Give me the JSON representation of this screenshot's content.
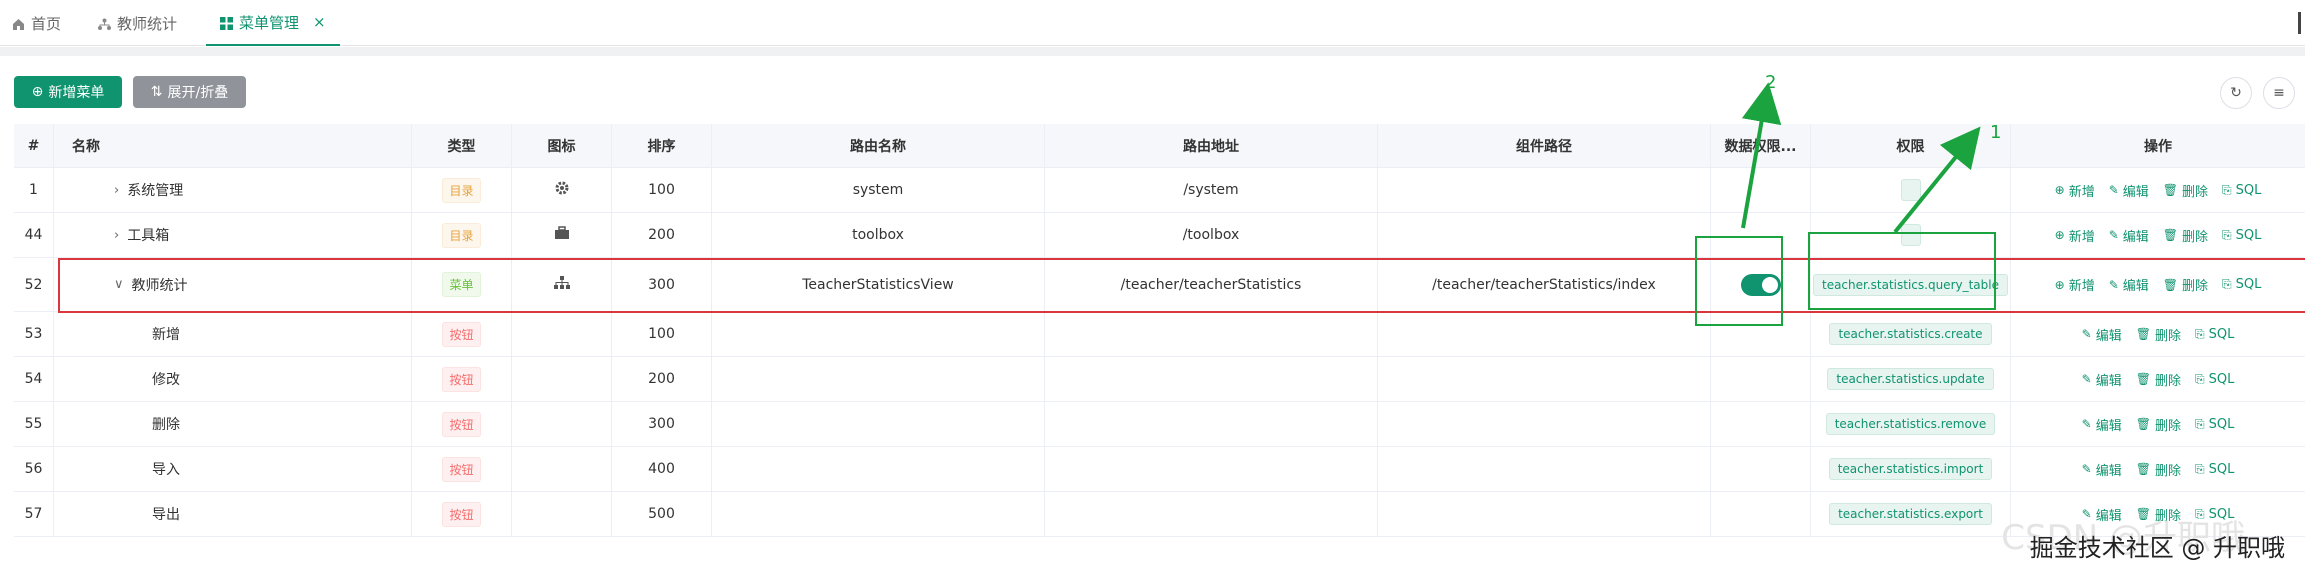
{
  "tabs": [
    {
      "label": "首页",
      "icon": "home-icon"
    },
    {
      "label": "教师统计",
      "icon": "chart-icon"
    },
    {
      "label": "菜单管理",
      "icon": "grid-icon",
      "active": true
    }
  ],
  "toolbar": {
    "add_label": "新增菜单",
    "expand_label": "展开/折叠"
  },
  "table": {
    "headers": [
      "#",
      "名称",
      "类型",
      "图标",
      "排序",
      "路由名称",
      "路由地址",
      "组件路径",
      "数据权限...",
      "权限",
      "操作"
    ],
    "rows": [
      {
        "id": "1",
        "name": "系统管理",
        "type": "目录",
        "icon": "gear-icon",
        "sort": "100",
        "route_name": "system",
        "route_path": "/system",
        "component": "",
        "perm": ""
      },
      {
        "id": "44",
        "name": "工具箱",
        "type": "目录",
        "icon": "briefcase-icon",
        "sort": "200",
        "route_name": "toolbox",
        "route_path": "/toolbox",
        "component": "",
        "perm": ""
      },
      {
        "id": "52",
        "name": "教师统计",
        "type": "菜单",
        "icon": "sitemap-icon",
        "sort": "300",
        "route_name": "TeacherStatisticsView",
        "route_path": "/teacher/teacherStatistics",
        "component": "/teacher/teacherStatistics/index",
        "perm": "teacher.statistics.query_table"
      },
      {
        "id": "53",
        "name": "新增",
        "type": "按钮",
        "sort": "100",
        "perm": "teacher.statistics.create"
      },
      {
        "id": "54",
        "name": "修改",
        "type": "按钮",
        "sort": "200",
        "perm": "teacher.statistics.update"
      },
      {
        "id": "55",
        "name": "删除",
        "type": "按钮",
        "sort": "300",
        "perm": "teacher.statistics.remove"
      },
      {
        "id": "56",
        "name": "导入",
        "type": "按钮",
        "sort": "400",
        "perm": "teacher.statistics.import"
      },
      {
        "id": "57",
        "name": "导出",
        "type": "按钮",
        "sort": "500",
        "perm": "teacher.statistics.export"
      }
    ]
  },
  "ops": {
    "add": "新增",
    "edit": "编辑",
    "delete": "删除",
    "sql": "SQL"
  },
  "annotations": {
    "one": "1",
    "two": "2"
  },
  "watermark": "掘金技术社区 @ 升职哦",
  "watermark_bg": "CSDN @升职哦",
  "colors": {
    "primary": "#10936f",
    "highlight": "#d9363e",
    "annotation": "#1aa33f"
  }
}
